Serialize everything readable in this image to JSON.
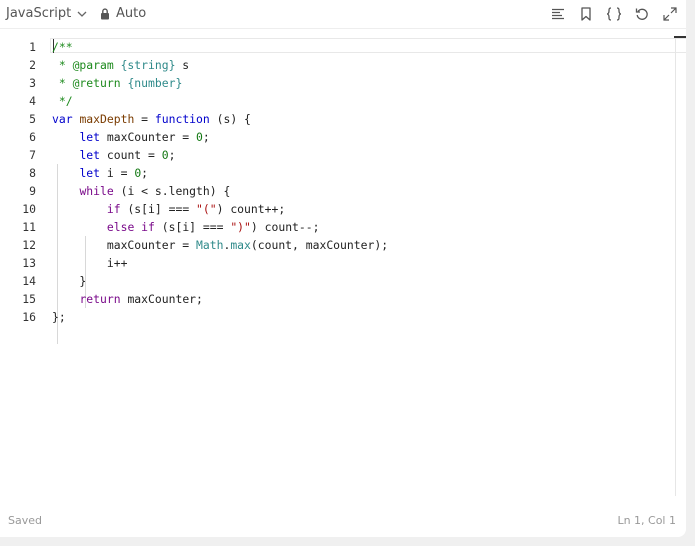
{
  "toolbar": {
    "language": "JavaScript",
    "mode": "Auto",
    "icons": [
      "format-icon",
      "bookmark-icon",
      "braces-icon",
      "reset-icon",
      "expand-icon"
    ]
  },
  "editor": {
    "line_numbers": [
      "1",
      "2",
      "3",
      "4",
      "5",
      "6",
      "7",
      "8",
      "9",
      "10",
      "11",
      "12",
      "13",
      "14",
      "15",
      "16"
    ]
  },
  "status": {
    "saved": "Saved",
    "position": "Ln 1, Col 1"
  }
}
